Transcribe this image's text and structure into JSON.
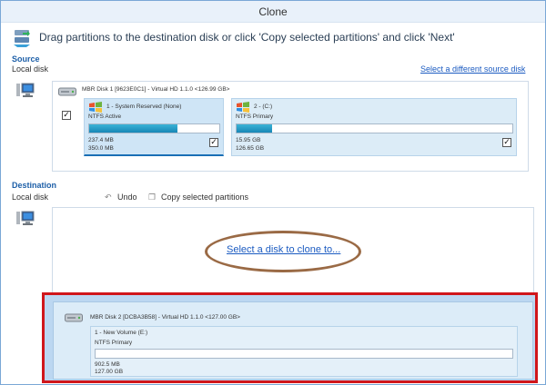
{
  "window": {
    "title": "Clone"
  },
  "header": {
    "instruction": "Drag partitions to the destination disk or click 'Copy selected partitions' and click 'Next'"
  },
  "source": {
    "section_label": "Source",
    "disk_type_label": "Local disk",
    "change_link": "Select a different source disk",
    "disk_header": "MBR Disk 1 [9623E0C1] - Virtual HD 1.1.0  <126.99 GB>",
    "disk_checked": true,
    "partitions": [
      {
        "title": "1 - System Reserved (None)",
        "type": "NTFS Active",
        "used": "237.4 MB",
        "total": "350.0 MB",
        "fill_fraction": 0.68,
        "checked": true,
        "selected": true
      },
      {
        "title": "2 - (C:)",
        "type": "NTFS Primary",
        "used": "15.95 GB",
        "total": "126.65 GB",
        "fill_fraction": 0.13,
        "checked": true,
        "selected": false
      }
    ]
  },
  "destination": {
    "section_label": "Destination",
    "disk_type_label": "Local disk",
    "undo_label": "Undo",
    "copy_label": "Copy selected partitions",
    "select_link": "Select a disk to clone to...",
    "drag_disk_header": "MBR Disk 2 [DCBA3B58] - Virtual HD 1.1.0  <127.00 GB>",
    "drag_partition": {
      "title": "1 - New Volume (E:)",
      "type": "NTFS Primary",
      "used": "902.5 MB",
      "total": "127.00 GB",
      "fill_fraction": 0.0
    }
  },
  "colors": {
    "accent": "#1b5bc1",
    "highlight_box": "#d0161b",
    "annotation_ellipse": "#9a6a45",
    "bar_fill": "#1787b6"
  }
}
